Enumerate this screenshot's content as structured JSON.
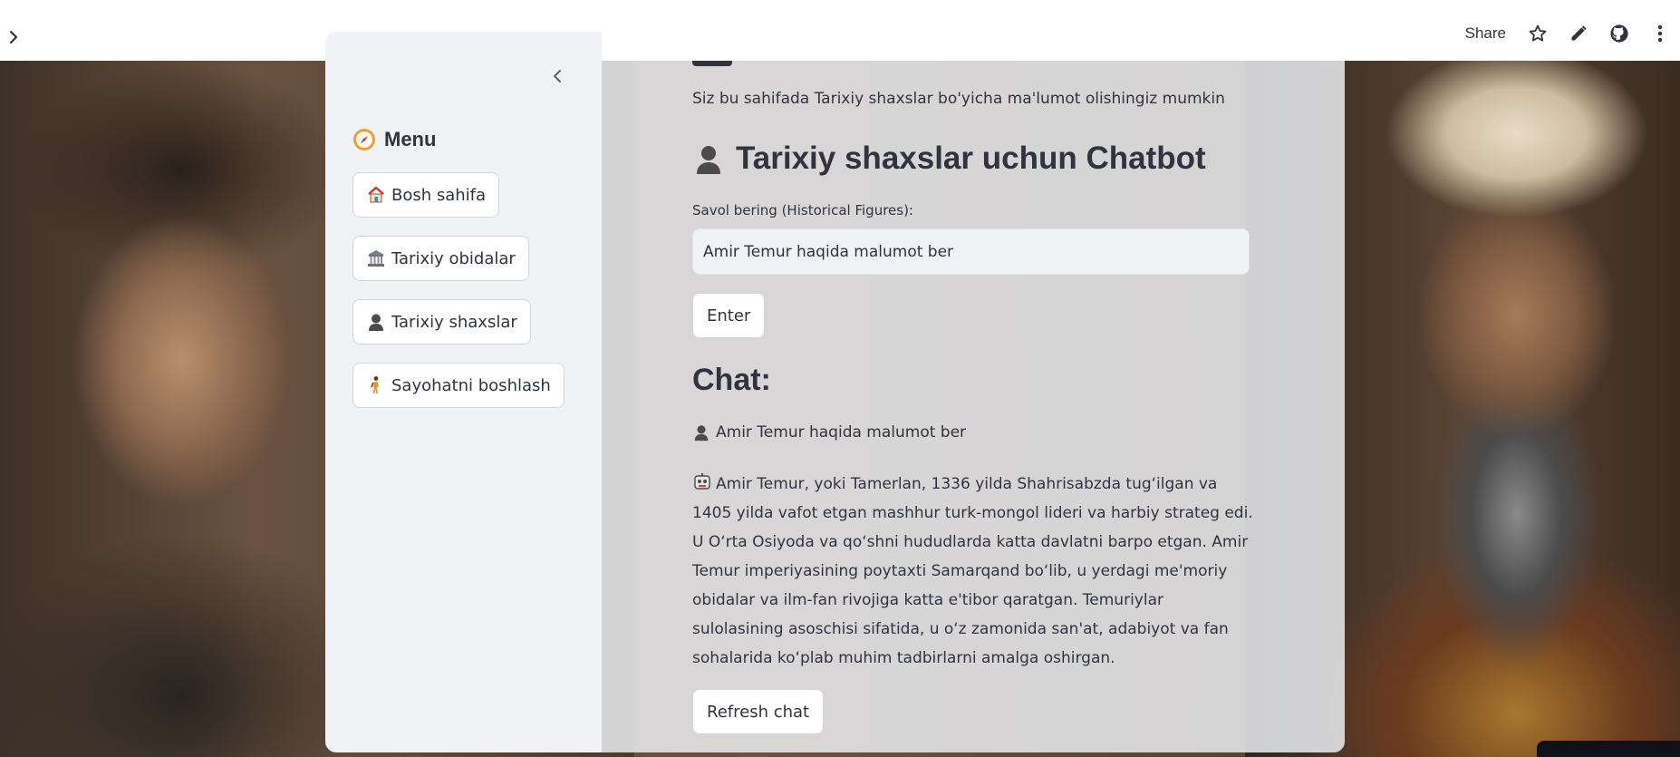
{
  "header": {
    "share_label": "Share",
    "icons": [
      "star-icon",
      "pencil-icon",
      "github-icon",
      "more-vertical-icon"
    ]
  },
  "sidebar": {
    "menu_title": "Menu",
    "items": [
      {
        "icon": "house-icon",
        "label": "Bosh sahifa"
      },
      {
        "icon": "classical-building-icon",
        "label": "Tarixiy obidalar"
      },
      {
        "icon": "person-icon",
        "label": "Tarixiy shaxslar"
      },
      {
        "icon": "walking-person-icon",
        "label": "Sayohatni boshlash"
      }
    ]
  },
  "main": {
    "subtitle": "Siz bu sahifada Tarixiy shaxslar bo'yicha ma'lumot olishingiz mumkin",
    "heading": "Tarixiy shaxslar uchun Chatbot",
    "input_label": "Savol bering (Historical Figures):",
    "input_value": "Amir Temur haqida malumot ber",
    "enter_label": "Enter",
    "chat_title": "Chat:",
    "user_message": "Amir Temur haqida malumot ber",
    "bot_message": "Amir Temur, yoki Tamerlan, 1336 yilda Shahrisabzda tug‘ilgan va 1405 yilda vafot etgan mashhur turk-mongol lideri va harbiy strateg edi. U O‘rta Osiyoda va qo‘shni hududlarda katta davlatni barpo etgan. Amir Temur imperiyasining poytaxti Samarqand bo‘lib, u yerdagi me'moriy obidalar va ilm-fan rivojiga katta e'tibor qaratgan. Temuriylar sulolasining asoschisi sifatida, u o‘z zamonida san'at, adabiyot va fan sohalarida ko‘plab muhim tadbirlarni amalga oshirgan.",
    "refresh_label": "Refresh chat"
  }
}
